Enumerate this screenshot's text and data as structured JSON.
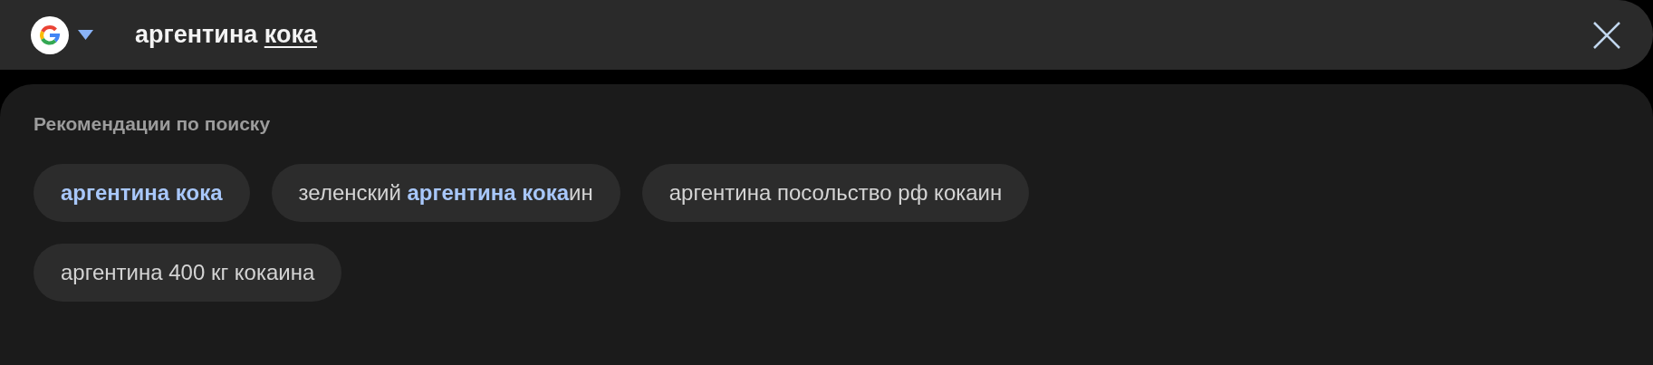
{
  "search_bar": {
    "query": "аргентина",
    "composing_text": "кока"
  },
  "suggestions": {
    "heading": "Рекомендации по поиску",
    "chips": [
      {
        "text": "**аргентина кока**"
      },
      {
        "text": "зеленский **аргентина кока**ин"
      },
      {
        "text": "аргентина посольство рф кокаин"
      },
      {
        "text": "аргентина 400 кг кокаина"
      }
    ]
  }
}
